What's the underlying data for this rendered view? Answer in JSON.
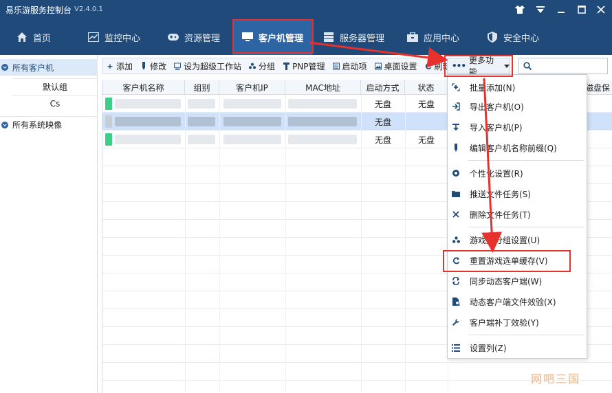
{
  "window": {
    "title": "易乐游服务控制台",
    "version": "V2.4.0.1"
  },
  "nav": {
    "items": [
      {
        "label": "首页",
        "icon": "home-icon"
      },
      {
        "label": "监控中心",
        "icon": "monitor-chart-icon"
      },
      {
        "label": "资源管理",
        "icon": "gamepad-icon"
      },
      {
        "label": "客户机管理",
        "icon": "display-icon",
        "active": true
      },
      {
        "label": "服务器管理",
        "icon": "server-icon"
      },
      {
        "label": "应用中心",
        "icon": "app-box-icon"
      },
      {
        "label": "安全中心",
        "icon": "shield-icon"
      }
    ]
  },
  "sidebar": {
    "groups": [
      {
        "label": "所有客户机",
        "children": [
          "默认组",
          "Cs"
        ]
      },
      {
        "label": "所有系统映像",
        "children": []
      }
    ]
  },
  "toolbar": {
    "buttons": [
      "添加",
      "修改",
      "设为超级工作站",
      "分组",
      "PNP管理",
      "启动项",
      "桌面设置",
      "刷新"
    ],
    "more_label": "更多功能",
    "search_placeholder": ""
  },
  "table": {
    "columns": [
      "客户机名称",
      "组别",
      "客户机IP",
      "MAC地址",
      "启动方式",
      "状态",
      "",
      "",
      "磁盘保"
    ],
    "rows": [
      {
        "boot": "无盘",
        "status": "无盘"
      },
      {
        "boot": "无盘",
        "status": ""
      },
      {
        "boot": "无盘",
        "status": "无盘"
      }
    ]
  },
  "menu": {
    "items": [
      {
        "label": "批量添加(N)",
        "icon": "batch-add-icon"
      },
      {
        "label": "导出客户机(O)",
        "icon": "export-icon"
      },
      {
        "label": "导入客户机(P)",
        "icon": "import-icon"
      },
      {
        "label": "编辑客户机名称前缀(Q)",
        "icon": "edit-pen-icon"
      },
      {
        "label": "个性化设置(R)",
        "icon": "gear-icon"
      },
      {
        "label": "推送文件任务(S)",
        "icon": "folder-icon"
      },
      {
        "label": "删除文件任务(T)",
        "icon": "delete-icon"
      },
      {
        "label": "游戏盘分组设置(U)",
        "icon": "group-icon"
      },
      {
        "label": "重置游戏选单缓存(V)",
        "icon": "reset-icon"
      },
      {
        "label": "同步动态客户端(W)",
        "icon": "sync-icon"
      },
      {
        "label": "动态客户端文件效验(X)",
        "icon": "file-verify-icon"
      },
      {
        "label": "客户端补丁效验(Y)",
        "icon": "wrench-icon"
      },
      {
        "label": "设置列(Z)",
        "icon": "column-settings-icon"
      }
    ]
  },
  "watermark": "网吧三国",
  "colors": {
    "nav_bg": "#1f4a79",
    "nav_active": "#2c64a4",
    "highlight_red": "#e7312c",
    "status_green": "#3ccf86"
  }
}
